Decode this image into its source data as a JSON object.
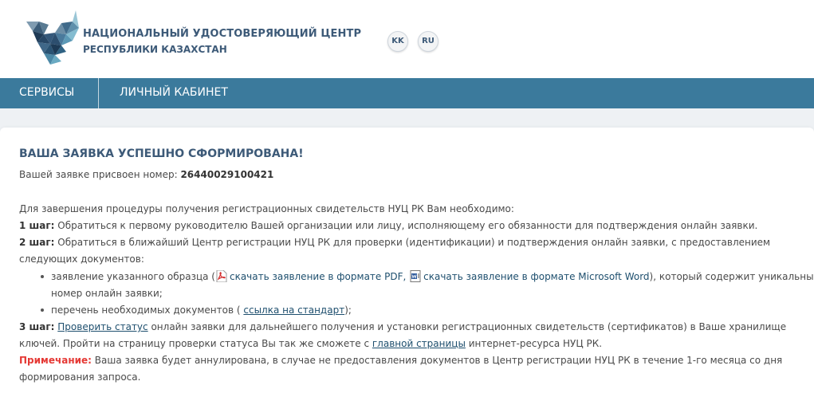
{
  "header": {
    "org_line1": "НАЦИОНАЛЬНЫЙ УДОСТОВЕРЯЮЩИЙ ЦЕНТР",
    "org_line2": "РЕСПУБЛИКИ КАЗАХСТАН",
    "lang_kk": "KK",
    "lang_ru": "RU"
  },
  "nav": {
    "services": "СЕРВИСЫ",
    "cabinet": "ЛИЧНЫЙ КАБИНЕТ"
  },
  "main": {
    "title": "ВАША ЗАЯВКА УСПЕШНО СФОРМИРОВАНА!",
    "number_label": "Вашей заявке присвоен номер: ",
    "number_value": "26440029100421",
    "intro": "Для завершения процедуры получения регистрационных свидетельств НУЦ РК Вам необходимо:",
    "step1_label": "1 шаг:",
    "step1_text": " Обратиться к первому руководителю Вашей организации или лицу, исполняющему его обязанности для подтверждения онлайн заявки.",
    "step2_label": "2 шаг:",
    "step2_text_a": " Обратиться в ближайший Центр регистрации НУЦ РК для проверки (идентификации) и подтверждения онлайн заявки, с предоставлением",
    "step2_text_b": "следующих документов:",
    "bullet1_a": "заявление указанного образца (",
    "pdf_link": "скачать заявление в формате PDF,",
    "word_link": "скачать заявление в формате Microsoft Word",
    "bullet1_b": "), который содержит уникальный",
    "bullet1_c": "номер онлайн заявки;",
    "bullet2_a": "перечень необходимых документов ( ",
    "standard_link": "ссылка на стандарт",
    "bullet2_b": ");",
    "step3_label": "3 шаг:",
    "check_status_link": "Проверить статус",
    "step3_text_a": " онлайн заявки для дальнейшего получения и установки регистрационных свидетельств (сертификатов) в Ваше хранилище",
    "step3_text_b": "ключей. Пройти на страницу проверки статуса Вы так же сможете с ",
    "main_page_link": "главной страницы",
    "step3_text_c": " интернет-ресурса НУЦ РК.",
    "note_label": "Примечание:",
    "note_text_a": " Ваша заявка будет аннулирована, в случае не предоставления документов в Центр регистрации НУЦ РК в течение 1-го месяца со дня",
    "note_text_b": "формирования запроса."
  },
  "icons": {
    "logo": "nuc-logo",
    "pdf": "pdf-file-icon",
    "word": "word-file-icon"
  },
  "colors": {
    "nav_bg": "#3b7a9c",
    "title": "#3d5a78",
    "note": "#e53935",
    "link": "#1e4f6e"
  }
}
